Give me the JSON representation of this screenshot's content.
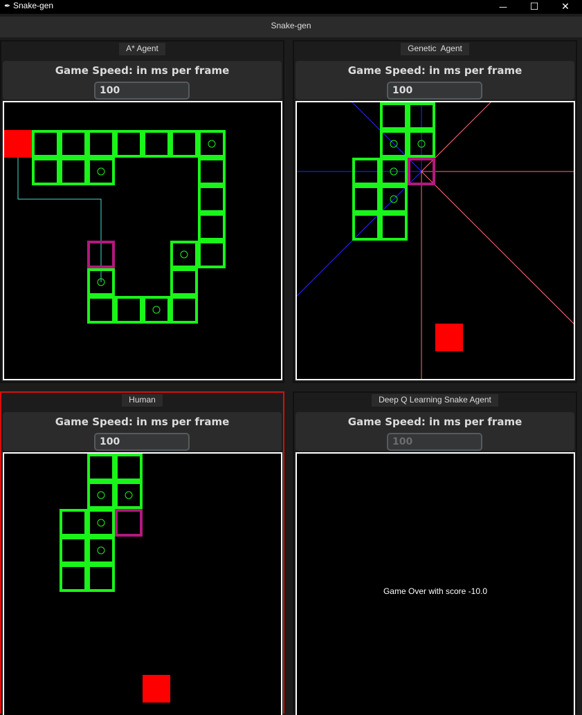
{
  "window": {
    "title": "Snake-gen",
    "controls": {
      "minimize": "—",
      "maximize": "☐",
      "close": "✕"
    }
  },
  "header": {
    "title": "Snake-gen"
  },
  "colors": {
    "snake": "#19f519",
    "head": "#b3187e",
    "food": "#ff0000",
    "path": "#40e0d0",
    "ray_blue": "#2828ff",
    "ray_red": "#ff7070",
    "focus_border": "#d80f0f"
  },
  "panels": [
    {
      "tab": "A* Agent",
      "speed_label": "Game Speed: in ms per frame",
      "speed_value": "100",
      "game": {
        "grid": 10,
        "body": [
          [
            1,
            1
          ],
          [
            2,
            1
          ],
          [
            3,
            1
          ],
          [
            4,
            1
          ],
          [
            5,
            1
          ],
          [
            6,
            1
          ],
          [
            7,
            1
          ],
          [
            1,
            2
          ],
          [
            2,
            2
          ],
          [
            3,
            2
          ],
          [
            7,
            2
          ],
          [
            7,
            3
          ],
          [
            7,
            4
          ],
          [
            6,
            5
          ],
          [
            7,
            5
          ],
          [
            3,
            6
          ],
          [
            6,
            6
          ],
          [
            3,
            7
          ],
          [
            4,
            7
          ],
          [
            5,
            7
          ],
          [
            6,
            7
          ]
        ],
        "dots": [
          [
            7,
            1
          ],
          [
            3,
            2
          ],
          [
            6,
            5
          ],
          [
            3,
            6
          ],
          [
            5,
            7
          ]
        ],
        "head": [
          3,
          5
        ],
        "food": [
          0,
          1
        ],
        "path": [
          [
            0,
            1
          ],
          [
            0,
            3
          ],
          [
            3,
            3
          ],
          [
            3,
            6
          ]
        ]
      }
    },
    {
      "tab": "Genetic  Agent",
      "speed_label": "Game Speed: in ms per frame",
      "speed_value": "100",
      "game": {
        "grid": 10,
        "body": [
          [
            3,
            0
          ],
          [
            4,
            0
          ],
          [
            3,
            1
          ],
          [
            4,
            1
          ],
          [
            2,
            2
          ],
          [
            3,
            2
          ],
          [
            2,
            3
          ],
          [
            3,
            3
          ],
          [
            2,
            4
          ],
          [
            3,
            4
          ]
        ],
        "dots": [
          [
            3,
            1
          ],
          [
            4,
            1
          ],
          [
            3,
            2
          ],
          [
            3,
            3
          ]
        ],
        "head": [
          4,
          2
        ],
        "food": [
          5,
          8
        ],
        "rays": "on"
      }
    },
    {
      "tab": "Human",
      "speed_label": "Game Speed: in ms per frame",
      "speed_value": "100",
      "focused": true,
      "game": {
        "grid": 10,
        "body": [
          [
            3,
            0
          ],
          [
            4,
            0
          ],
          [
            3,
            1
          ],
          [
            4,
            1
          ],
          [
            2,
            2
          ],
          [
            3,
            2
          ],
          [
            2,
            3
          ],
          [
            3,
            3
          ],
          [
            2,
            4
          ],
          [
            3,
            4
          ]
        ],
        "dots": [
          [
            3,
            1
          ],
          [
            4,
            1
          ],
          [
            3,
            2
          ],
          [
            3,
            3
          ]
        ],
        "head": [
          4,
          2
        ],
        "food": [
          5,
          8
        ]
      }
    },
    {
      "tab": "Deep Q Learning Snake Agent",
      "speed_label": "Game Speed: in ms per frame",
      "speed_value": "100",
      "disabled": true,
      "game": {
        "message": "Game Over with score -10.0"
      }
    }
  ]
}
